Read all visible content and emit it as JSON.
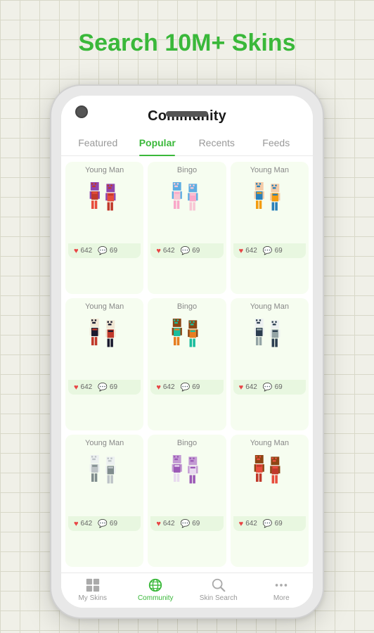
{
  "headline": "Search 10M+ Skins",
  "app": {
    "title": "Community",
    "tabs": [
      {
        "id": "featured",
        "label": "Featured",
        "active": false
      },
      {
        "id": "popular",
        "label": "Popular",
        "active": true
      },
      {
        "id": "recents",
        "label": "Recents",
        "active": false
      },
      {
        "id": "feeds",
        "label": "Feeds",
        "active": false
      }
    ],
    "skins": [
      {
        "name": "Young Man",
        "likes": "642",
        "comments": "69",
        "palette": [
          "#c0392b",
          "#e74c3c",
          "#8e44ad"
        ]
      },
      {
        "name": "Bingo",
        "likes": "642",
        "comments": "69",
        "palette": [
          "#f7c6d4",
          "#f9a8c9",
          "#5dade2"
        ]
      },
      {
        "name": "Young Man",
        "likes": "642",
        "comments": "69",
        "palette": [
          "#2980b9",
          "#f39c12",
          "#f5cba7"
        ]
      },
      {
        "name": "Young Man",
        "likes": "642",
        "comments": "69",
        "palette": [
          "#1a1a2e",
          "#c0392b",
          "#f0e6d3"
        ]
      },
      {
        "name": "Bingo",
        "likes": "642",
        "comments": "69",
        "palette": [
          "#1abc9c",
          "#e67e22",
          "#8b4513"
        ]
      },
      {
        "name": "Young Man",
        "likes": "642",
        "comments": "69",
        "palette": [
          "#2c3e50",
          "#95a5a6",
          "#ecf0f1"
        ]
      },
      {
        "name": "Young Man",
        "likes": "642",
        "comments": "69",
        "palette": [
          "#bdc3c7",
          "#7f8c8d",
          "#ecf0f1"
        ]
      },
      {
        "name": "Bingo",
        "likes": "642",
        "comments": "69",
        "palette": [
          "#9b59b6",
          "#e8daef",
          "#c39bd3"
        ]
      },
      {
        "name": "Young Man",
        "likes": "642",
        "comments": "69",
        "palette": [
          "#e74c3c",
          "#c0392b",
          "#8b4513"
        ]
      }
    ],
    "nav": [
      {
        "id": "my-skins",
        "label": "My Skins",
        "icon": "grid",
        "active": false
      },
      {
        "id": "community",
        "label": "Community",
        "icon": "globe",
        "active": true
      },
      {
        "id": "skin-search",
        "label": "Skin Search",
        "icon": "search",
        "active": false
      },
      {
        "id": "more",
        "label": "More",
        "icon": "dots",
        "active": false
      }
    ]
  }
}
